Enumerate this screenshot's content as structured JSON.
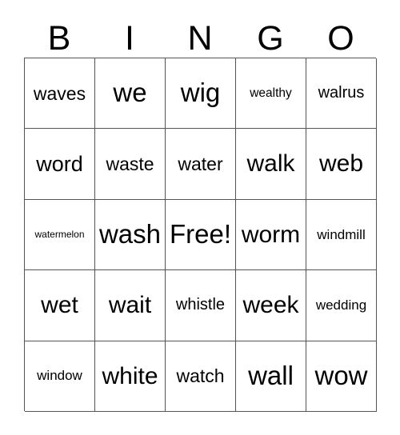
{
  "card": {
    "header": {
      "letters": [
        "B",
        "I",
        "N",
        "G",
        "O"
      ]
    },
    "colors": {
      "background": "#ffffff",
      "border": "#555555",
      "text": "#000000"
    },
    "grid": {
      "columns": 5,
      "rows": 5,
      "free_space": {
        "row": 3,
        "column": 3,
        "label": "Free!"
      },
      "cells": [
        [
          {
            "label": "waves",
            "size": "md"
          },
          {
            "label": "we",
            "size": "xxl"
          },
          {
            "label": "wig",
            "size": "xxl"
          },
          {
            "label": "wealthy",
            "size": "xxs"
          },
          {
            "label": "walrus",
            "size": "sm"
          }
        ],
        [
          {
            "label": "word",
            "size": "lg"
          },
          {
            "label": "waste",
            "size": "md"
          },
          {
            "label": "water",
            "size": "md"
          },
          {
            "label": "walk",
            "size": "xl"
          },
          {
            "label": "web",
            "size": "xl"
          }
        ],
        [
          {
            "label": "watermelon",
            "size": "tiny"
          },
          {
            "label": "wash",
            "size": "xxl"
          },
          {
            "label": "Free!",
            "size": "xxl"
          },
          {
            "label": "worm",
            "size": "xl"
          },
          {
            "label": "windmill",
            "size": "xs"
          }
        ],
        [
          {
            "label": "wet",
            "size": "xl"
          },
          {
            "label": "wait",
            "size": "xl"
          },
          {
            "label": "whistle",
            "size": "sm"
          },
          {
            "label": "week",
            "size": "xl"
          },
          {
            "label": "wedding",
            "size": "xs"
          }
        ],
        [
          {
            "label": "window",
            "size": "xs"
          },
          {
            "label": "white",
            "size": "xl"
          },
          {
            "label": "watch",
            "size": "md"
          },
          {
            "label": "wall",
            "size": "xxl"
          },
          {
            "label": "wow",
            "size": "xxl"
          }
        ]
      ]
    }
  }
}
